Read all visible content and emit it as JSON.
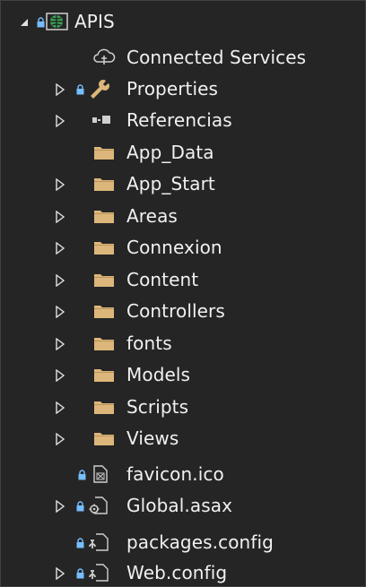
{
  "solution_explorer": {
    "project": {
      "name": "APIS",
      "expanded": true,
      "icon": "web-project-icon"
    },
    "items": [
      {
        "label": "Connected Services",
        "icon": "connected-services-icon",
        "expandable": false,
        "locked": false
      },
      {
        "label": "Properties",
        "icon": "wrench-icon",
        "expandable": true,
        "locked": true
      },
      {
        "label": "Referencias",
        "icon": "references-icon",
        "expandable": true,
        "locked": false
      },
      {
        "label": "App_Data",
        "icon": "folder-icon",
        "expandable": false,
        "locked": false
      },
      {
        "label": "App_Start",
        "icon": "folder-icon",
        "expandable": true,
        "locked": false
      },
      {
        "label": "Areas",
        "icon": "folder-icon",
        "expandable": true,
        "locked": false
      },
      {
        "label": "Connexion",
        "icon": "folder-icon",
        "expandable": true,
        "locked": false
      },
      {
        "label": "Content",
        "icon": "folder-icon",
        "expandable": true,
        "locked": false
      },
      {
        "label": "Controllers",
        "icon": "folder-icon",
        "expandable": true,
        "locked": false
      },
      {
        "label": "fonts",
        "icon": "folder-icon",
        "expandable": true,
        "locked": false
      },
      {
        "label": "Models",
        "icon": "folder-icon",
        "expandable": true,
        "locked": false
      },
      {
        "label": "Scripts",
        "icon": "folder-icon",
        "expandable": true,
        "locked": false
      },
      {
        "label": "Views",
        "icon": "folder-icon",
        "expandable": true,
        "locked": false
      },
      {
        "label": "favicon.ico",
        "icon": "icon-file-icon",
        "expandable": false,
        "locked": true
      },
      {
        "label": "Global.asax",
        "icon": "asax-file-icon",
        "expandable": true,
        "locked": true
      },
      {
        "label": "packages.config",
        "icon": "config-file-icon",
        "expandable": false,
        "locked": true
      },
      {
        "label": "Web.config",
        "icon": "config-file-icon",
        "expandable": true,
        "locked": true
      }
    ]
  },
  "colors": {
    "background": "#252526",
    "text": "#f1f1f1",
    "folder": "#dcb67a",
    "lock": "#75beff",
    "project_icon": "#2da44e"
  }
}
